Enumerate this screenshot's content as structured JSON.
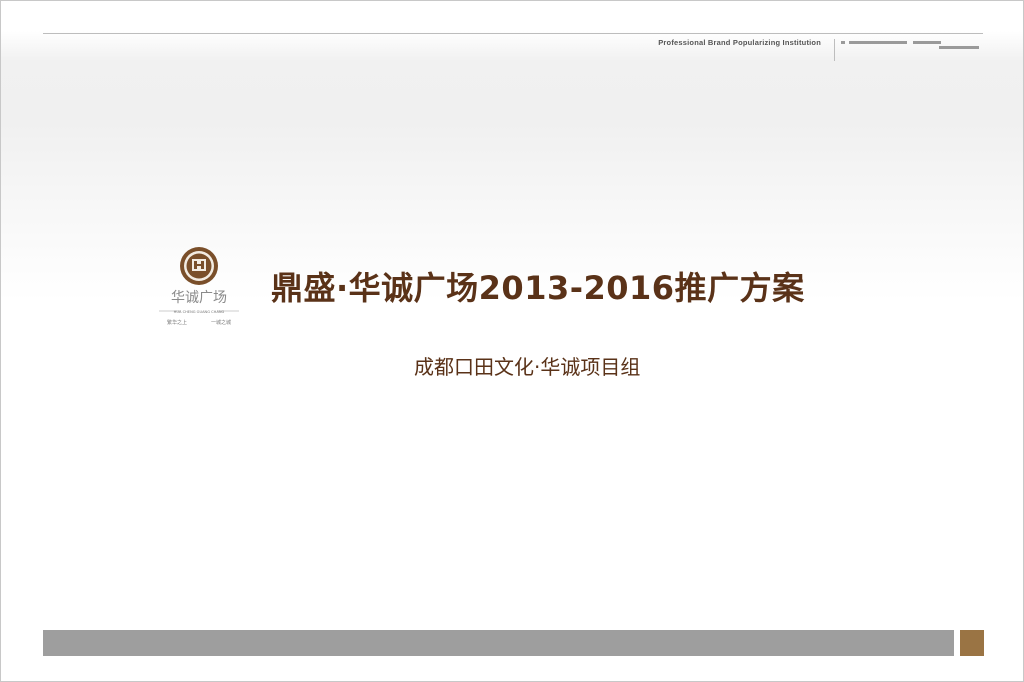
{
  "header": {
    "tagline": "Professional Brand Popularizing Institution"
  },
  "logo": {
    "name_cn": "华诚广场",
    "name_pinyin": "HUA CHENG GUANG CHANG",
    "motto_left": "繁华之上",
    "motto_right": "一城之城"
  },
  "slide": {
    "title": "鼎盛·华诚广场2013-2016推广方案",
    "subtitle": "成都口田文化·华诚项目组"
  },
  "colors": {
    "title": "#5a3218",
    "footer_bar": "#9e9e9e",
    "footer_accent": "#9a7444",
    "logo_brown": "#7a4f2a"
  }
}
